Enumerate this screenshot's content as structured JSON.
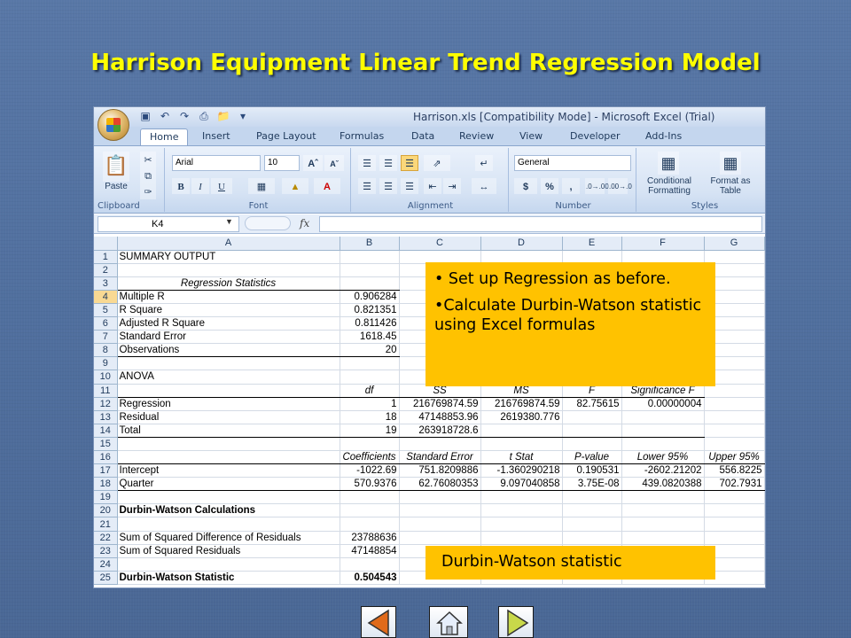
{
  "slide": {
    "title": "Harrison Equipment Linear Trend Regression Model",
    "callout_points": [
      "• Set up Regression as before.",
      "•Calculate Durbin-Watson statistic using Excel formulas"
    ],
    "callout_dw": "Durbin-Watson statistic"
  },
  "window": {
    "title": "Harrison.xls  [Compatibility Mode]  -  Microsoft Excel (Trial)"
  },
  "ribbon": {
    "tabs": [
      "Home",
      "Insert",
      "Page Layout",
      "Formulas",
      "Data",
      "Review",
      "View",
      "Developer",
      "Add-Ins"
    ],
    "paste_label": "Paste",
    "font_name": "Arial",
    "font_size": "10",
    "number_format": "General",
    "conditional_formatting": "Conditional Formatting",
    "format_as_table": "Format as Table",
    "groups": {
      "clipboard": "Clipboard",
      "font": "Font",
      "alignment": "Alignment",
      "number": "Number",
      "styles": "Styles"
    }
  },
  "formula_bar": {
    "name_box": "K4",
    "fx": "fx",
    "formula": ""
  },
  "sheet": {
    "columns": [
      "A",
      "B",
      "C",
      "D",
      "E",
      "F",
      "G"
    ],
    "rows": [
      {
        "n": "1",
        "cells": [
          "SUMMARY OUTPUT",
          "",
          "",
          "",
          "",
          "",
          ""
        ]
      },
      {
        "n": "2",
        "cells": [
          "",
          "",
          "",
          "",
          "",
          "",
          ""
        ]
      },
      {
        "n": "3",
        "cells": [
          "Regression Statistics",
          "",
          "",
          "",
          "",
          "",
          ""
        ]
      },
      {
        "n": "4",
        "cells": [
          "Multiple R",
          "0.906284",
          "",
          "",
          "",
          "",
          ""
        ]
      },
      {
        "n": "5",
        "cells": [
          "R Square",
          "0.821351",
          "",
          "",
          "",
          "",
          ""
        ]
      },
      {
        "n": "6",
        "cells": [
          "Adjusted R Square",
          "0.811426",
          "",
          "",
          "",
          "",
          ""
        ]
      },
      {
        "n": "7",
        "cells": [
          "Standard Error",
          "1618.45",
          "",
          "",
          "",
          "",
          ""
        ]
      },
      {
        "n": "8",
        "cells": [
          "Observations",
          "20",
          "",
          "",
          "",
          "",
          ""
        ]
      },
      {
        "n": "9",
        "cells": [
          "",
          "",
          "",
          "",
          "",
          "",
          ""
        ]
      },
      {
        "n": "10",
        "cells": [
          "ANOVA",
          "",
          "",
          "",
          "",
          "",
          ""
        ]
      },
      {
        "n": "11",
        "cells": [
          "",
          "df",
          "SS",
          "MS",
          "F",
          "Significance F",
          ""
        ]
      },
      {
        "n": "12",
        "cells": [
          "Regression",
          "1",
          "216769874.59",
          "216769874.59",
          "82.75615",
          "0.00000004",
          ""
        ]
      },
      {
        "n": "13",
        "cells": [
          "Residual",
          "18",
          "47148853.96",
          "2619380.776",
          "",
          "",
          ""
        ]
      },
      {
        "n": "14",
        "cells": [
          "Total",
          "19",
          "263918728.6",
          "",
          "",
          "",
          ""
        ]
      },
      {
        "n": "15",
        "cells": [
          "",
          "",
          "",
          "",
          "",
          "",
          ""
        ]
      },
      {
        "n": "16",
        "cells": [
          "",
          "Coefficients",
          "Standard Error",
          "t Stat",
          "P-value",
          "Lower 95%",
          "Upper 95%"
        ]
      },
      {
        "n": "17",
        "cells": [
          "Intercept",
          "-1022.69",
          "751.8209886",
          "-1.360290218",
          "0.190531",
          "-2602.21202",
          "556.8225"
        ]
      },
      {
        "n": "18",
        "cells": [
          "Quarter",
          "570.9376",
          "62.76080353",
          "9.097040858",
          "3.75E-08",
          "439.0820388",
          "702.7931"
        ]
      },
      {
        "n": "19",
        "cells": [
          "",
          "",
          "",
          "",
          "",
          "",
          ""
        ]
      },
      {
        "n": "20",
        "cells": [
          "Durbin-Watson Calculations",
          "",
          "",
          "",
          "",
          "",
          ""
        ]
      },
      {
        "n": "21",
        "cells": [
          "",
          "",
          "",
          "",
          "",
          "",
          ""
        ]
      },
      {
        "n": "22",
        "cells": [
          "Sum of Squared Difference of Residuals",
          "23788636",
          "",
          "",
          "",
          "",
          ""
        ]
      },
      {
        "n": "23",
        "cells": [
          "Sum of Squared Residuals",
          "47148854",
          "",
          "",
          "",
          "",
          ""
        ]
      },
      {
        "n": "24",
        "cells": [
          "",
          "",
          "",
          "",
          "",
          "",
          ""
        ]
      },
      {
        "n": "25",
        "cells": [
          "Durbin-Watson Statistic",
          "0.504543",
          "",
          "",
          "",
          "",
          ""
        ]
      }
    ]
  },
  "icons": {
    "prev": "left-arrow-icon",
    "home": "home-icon",
    "next": "right-arrow-icon"
  },
  "colors": {
    "title": "#ffff00",
    "callout": "#ffc200",
    "slide_bg": "#5172a2"
  }
}
